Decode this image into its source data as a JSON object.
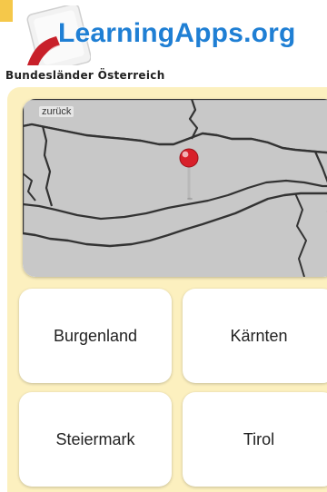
{
  "brand": {
    "name": "LearningApps.org",
    "color": "#1f7fd4",
    "accent": "#f5c84a"
  },
  "page": {
    "subtitle": "Bundesländer Österreich"
  },
  "map": {
    "back_label": "zurück",
    "marker_icon": "map-pin-icon",
    "land_color": "#c8c8c8"
  },
  "answers": [
    {
      "label": "Burgenland"
    },
    {
      "label": "Kärnten"
    },
    {
      "label": "Steiermark"
    },
    {
      "label": "Tirol"
    }
  ],
  "colors": {
    "panel": "#fcf0bf",
    "tile": "#ffffff"
  }
}
